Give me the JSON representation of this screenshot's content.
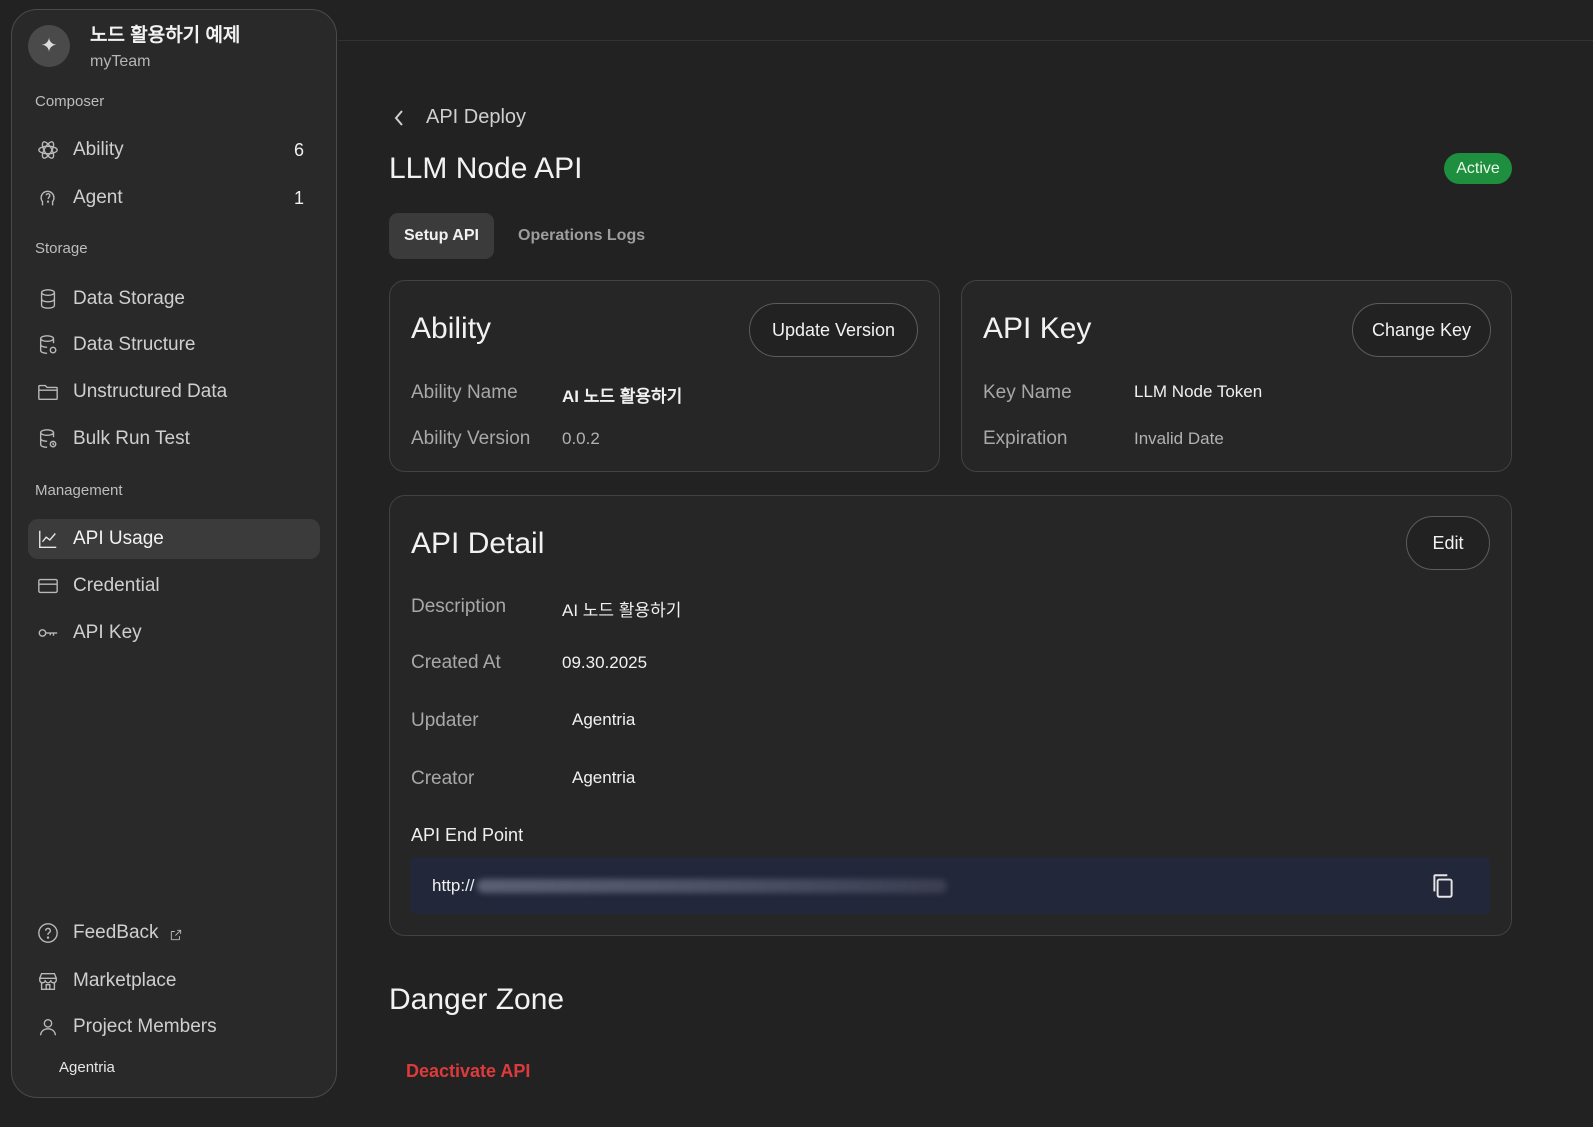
{
  "project": {
    "name": "노드 활용하기 예제",
    "team": "myTeam",
    "avatar_icon": "sparkle-icon"
  },
  "sidebar": {
    "composer_label": "Composer",
    "storage_label": "Storage",
    "management_label": "Management",
    "composer": [
      {
        "label": "Ability",
        "count": "6",
        "icon": "atom-icon"
      },
      {
        "label": "Agent",
        "count": "1",
        "icon": "agent-head-icon"
      }
    ],
    "storage": [
      {
        "label": "Data Storage",
        "icon": "database-icon"
      },
      {
        "label": "Data Structure",
        "icon": "database-settings-icon"
      },
      {
        "label": "Unstructured Data",
        "icon": "folder-icon"
      },
      {
        "label": "Bulk Run Test",
        "icon": "database-run-icon"
      }
    ],
    "management": [
      {
        "label": "API Usage",
        "icon": "line-chart-icon",
        "active": true
      },
      {
        "label": "Credential",
        "icon": "credit-card-icon"
      },
      {
        "label": "API Key",
        "icon": "key-icon"
      }
    ],
    "bottom": [
      {
        "label": "FeedBack",
        "icon": "help-circle-icon"
      },
      {
        "label": "Marketplace",
        "icon": "store-icon"
      },
      {
        "label": "Project Members",
        "icon": "user-icon"
      }
    ],
    "member_name": "Agentria"
  },
  "breadcrumb": {
    "back_label": "API Deploy"
  },
  "page": {
    "title": "LLM Node API",
    "status": "Active"
  },
  "tabs": [
    {
      "label": "Setup API",
      "active": true
    },
    {
      "label": "Operations Logs",
      "active": false
    }
  ],
  "ability_card": {
    "title": "Ability",
    "button": "Update Version",
    "name_label": "Ability Name",
    "name_value": "AI 노드 활용하기",
    "version_label": "Ability Version",
    "version_value": "0.0.2"
  },
  "apikey_card": {
    "title": "API Key",
    "button": "Change Key",
    "name_label": "Key Name",
    "name_value": "LLM Node Token",
    "exp_label": "Expiration",
    "exp_value": "Invalid Date"
  },
  "detail_card": {
    "title": "API Detail",
    "button": "Edit",
    "description_label": "Description",
    "description_value": "AI 노드 활용하기",
    "created_label": "Created At",
    "created_value": "09.30.2025",
    "updater_label": "Updater",
    "updater_value": "Agentria",
    "creator_label": "Creator",
    "creator_value": "Agentria",
    "endpoint_label": "API End Point",
    "endpoint_prefix": "http://"
  },
  "danger": {
    "title": "Danger Zone",
    "action": "Deactivate API"
  },
  "colors": {
    "active_badge": "#1e8f3e",
    "danger_text": "#dd3b3b",
    "endpoint_bg": "#23273a"
  }
}
